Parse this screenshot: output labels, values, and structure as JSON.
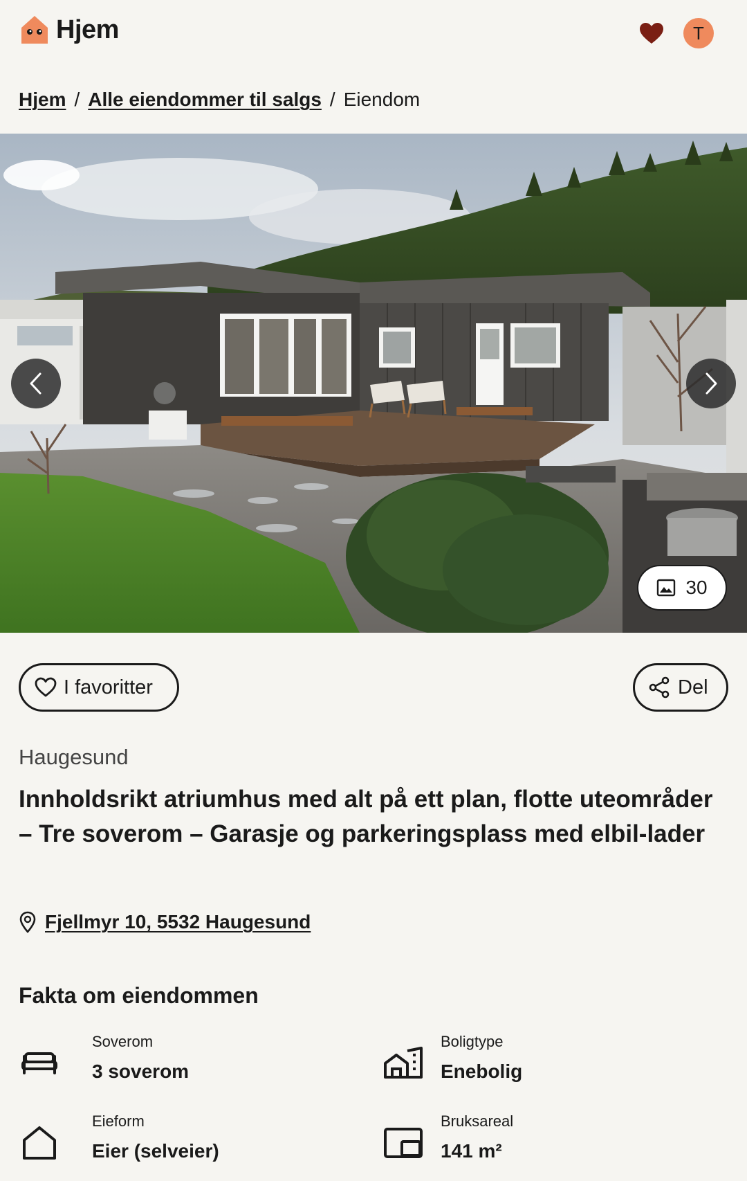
{
  "header": {
    "logo_text": "Hjem",
    "avatar_initial": "T",
    "favorites_icon": "heart-filled-icon",
    "brand_color": "#ef8a5d"
  },
  "breadcrumb": {
    "items": [
      {
        "label": "Hjem",
        "link": true
      },
      {
        "label": "Alle eiendommer til salgs",
        "link": true
      },
      {
        "label": "Eiendom",
        "link": false
      }
    ],
    "separator": "/"
  },
  "gallery": {
    "photo_count": "30",
    "prev_icon": "chevron-left-icon",
    "next_icon": "chevron-right-icon",
    "count_icon": "image-icon"
  },
  "actions": {
    "favorite_label": "I favoritter",
    "share_label": "Del"
  },
  "listing": {
    "city": "Haugesund",
    "title": "Innholdsrikt atriumhus med alt på ett plan, flotte uteområder – Tre soverom – Garasje og parkeringsplass med elbil-lader",
    "address": "Fjellmyr 10, 5532 Haugesund"
  },
  "facts": {
    "heading": "Fakta om eiendommen",
    "items": [
      {
        "label": "Soverom",
        "value": "3 soverom",
        "icon": "bed-icon"
      },
      {
        "label": "Boligtype",
        "value": "Enebolig",
        "icon": "building-icon"
      },
      {
        "label": "Eieform",
        "value": "Eier (selveier)",
        "icon": "house-icon"
      },
      {
        "label": "Bruksareal",
        "value": "141 m²",
        "icon": "floor-area-icon"
      }
    ]
  }
}
